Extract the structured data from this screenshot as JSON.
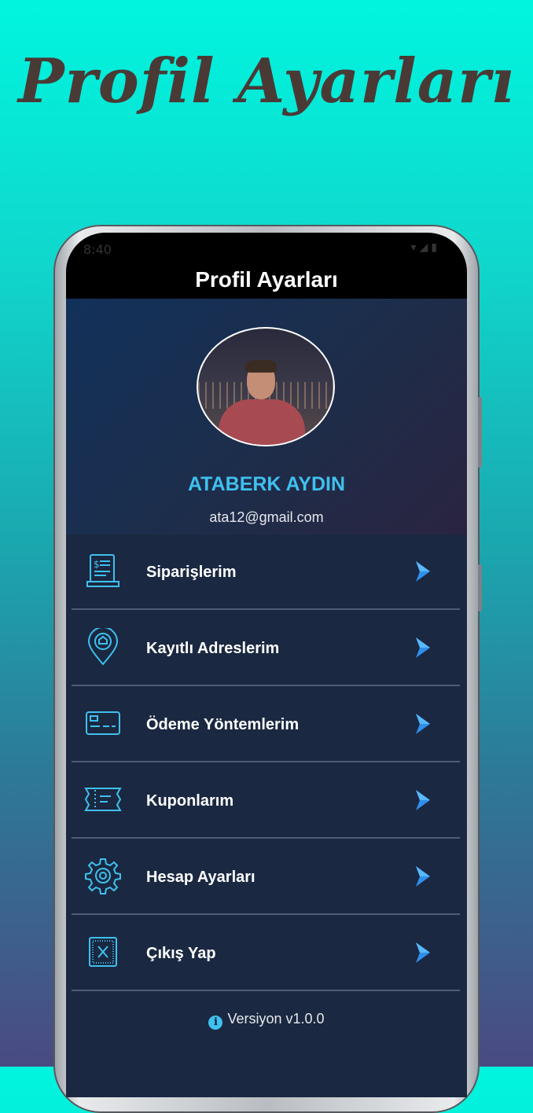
{
  "promo": {
    "title": "Profil Ayarları"
  },
  "status_bar": {
    "time": "8:40",
    "icons": [
      "wifi-icon",
      "signal-icon",
      "battery-icon"
    ]
  },
  "app_bar": {
    "title": "Profil Ayarları"
  },
  "profile": {
    "name": "ATABERK AYDIN",
    "email": "ata12@gmail.com"
  },
  "menu": {
    "items": [
      {
        "label": "Siparişlerim",
        "icon": "receipt-icon"
      },
      {
        "label": "Kayıtlı Adreslerim",
        "icon": "location-pin-icon"
      },
      {
        "label": "Ödeme Yöntemlerim",
        "icon": "credit-card-icon"
      },
      {
        "label": "Kuponlarım",
        "icon": "coupon-icon"
      },
      {
        "label": "Hesap Ayarları",
        "icon": "gear-icon"
      },
      {
        "label": "Çıkış Yap",
        "icon": "logout-x-icon"
      }
    ]
  },
  "footer": {
    "version": "Versiyon v1.0.0"
  },
  "colors": {
    "accent": "#3fc0ee",
    "menu_background": "#1a2841",
    "chevron": "#2f8fea",
    "promo_title": "#4a3a36"
  }
}
